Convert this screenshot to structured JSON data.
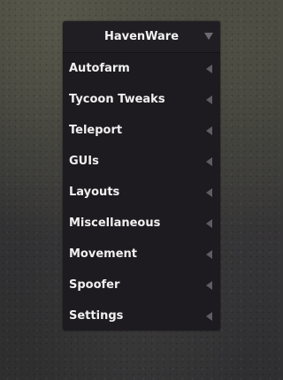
{
  "menu": {
    "title": "HavenWare",
    "header_icon": "caret-down-icon",
    "item_icon": "caret-left-icon",
    "items": [
      {
        "label": "Autofarm"
      },
      {
        "label": "Tycoon Tweaks"
      },
      {
        "label": "Teleport"
      },
      {
        "label": "GUIs"
      },
      {
        "label": "Layouts"
      },
      {
        "label": "Miscellaneous"
      },
      {
        "label": "Movement"
      },
      {
        "label": "Spoofer"
      },
      {
        "label": "Settings"
      }
    ]
  },
  "colors": {
    "panel_background": "#1d1b20",
    "text": "#f0f0f0",
    "arrow": "#5f5d64"
  }
}
